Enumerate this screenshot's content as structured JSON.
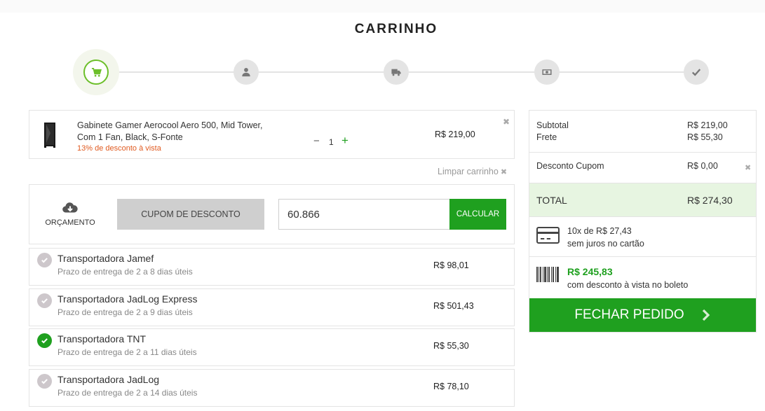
{
  "page": {
    "title": "CARRINHO"
  },
  "stepper": {
    "steps": [
      {
        "icon": "cart-icon",
        "state": "active"
      },
      {
        "icon": "user-icon",
        "state": "pending"
      },
      {
        "icon": "truck-icon",
        "state": "pending"
      },
      {
        "icon": "money-icon",
        "state": "pending"
      },
      {
        "icon": "check-icon",
        "state": "pending"
      }
    ]
  },
  "product": {
    "name": "Gabinete Gamer Aerocool Aero 500, Mid Tower, Com 1 Fan, Black, S-Fonte",
    "discount_note": "13% de desconto à vista",
    "qty_minus": "−",
    "quantity": "1",
    "qty_plus": "+",
    "price": "R$ 219,00",
    "remove": "✖"
  },
  "cart": {
    "clear_label": "Limpar carrinho",
    "clear_icon": "✖"
  },
  "coupon": {
    "budget_label": "ORÇAMENTO",
    "coupon_button": "CUPOM DE DESCONTO",
    "input_value": "60.866",
    "calc_button": "CALCULAR"
  },
  "shipping": [
    {
      "name": "Transportadora Jamef",
      "time": "Prazo de entrega de 2 a 8 dias úteis",
      "price": "R$ 98,01",
      "selected": false
    },
    {
      "name": "Transportadora JadLog Express",
      "time": "Prazo de entrega de 2 a 9 dias úteis",
      "price": "R$ 501,43",
      "selected": false
    },
    {
      "name": "Transportadora TNT",
      "time": "Prazo de entrega de 2 a 11 dias úteis",
      "price": "R$ 55,30",
      "selected": true
    },
    {
      "name": "Transportadora JadLog",
      "time": "Prazo de entrega de 2 a 14 dias úteis",
      "price": "R$ 78,10",
      "selected": false
    }
  ],
  "summary": {
    "subtotal_label": "Subtotal",
    "subtotal_value": "R$ 219,00",
    "freight_label": "Frete",
    "freight_value": "R$ 55,30",
    "coupon_label": "Desconto Cupom",
    "coupon_value": "R$ 0,00",
    "coupon_remove": "✖",
    "total_label": "TOTAL",
    "total_value": "R$ 274,30",
    "installments": "10x de R$ 27,43",
    "installments_note": "sem juros no cartão",
    "boleto_value": "R$ 245,83",
    "boleto_note": "com desconto à vista no boleto",
    "close_order": "FECHAR PEDIDO"
  },
  "colors": {
    "accent": "#1fa01f",
    "stepper_active": "#6cbf2a",
    "discount": "#e05a20",
    "total_bg": "#e7f5e1"
  }
}
